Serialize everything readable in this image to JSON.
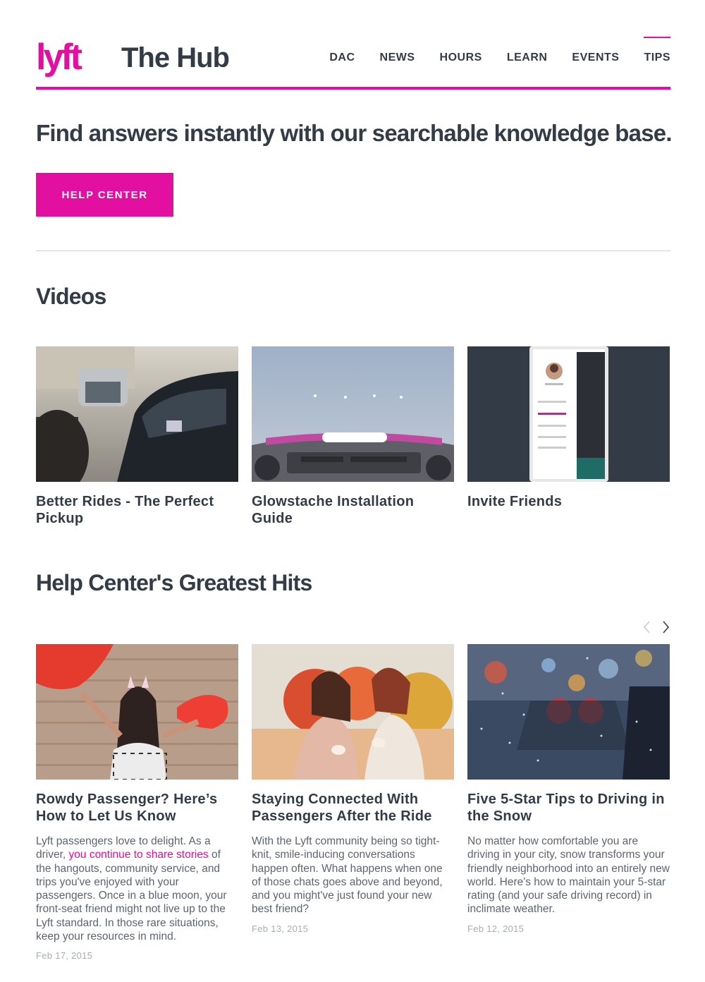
{
  "header": {
    "logo_text": "lyft",
    "site_title": "The Hub",
    "nav": [
      {
        "label": "DAC"
      },
      {
        "label": "NEWS"
      },
      {
        "label": "HOURS"
      },
      {
        "label": "LEARN"
      },
      {
        "label": "EVENTS"
      },
      {
        "label": "TIPS",
        "active": true
      }
    ]
  },
  "hero": {
    "heading": "Find answers instantly with our searchable knowledge base.",
    "button_label": "HELP CENTER"
  },
  "videos": {
    "title": "Videos",
    "items": [
      {
        "title": "Better Rides - The Perfect Pickup"
      },
      {
        "title": "Glowstache Installation Guide"
      },
      {
        "title": "Invite Friends"
      }
    ]
  },
  "hits": {
    "title": "Help Center's Greatest Hits",
    "prev_icon": "chevron-left-icon",
    "next_icon": "chevron-right-icon",
    "items": [
      {
        "title": "Rowdy Passenger? Here’s How to Let Us Know",
        "desc_before": "Lyft passengers love to delight. As a driver, ",
        "desc_link": "you continue to share stories",
        "desc_after": " of the hangouts, community service, and trips you've enjoyed with your passengers. Once in a blue moon, your front-seat friend might not live up to the Lyft standard. In those rare situations, keep your resources in mind.",
        "date": "Feb 17, 2015"
      },
      {
        "title": "Staying Connected With Passengers After the Ride",
        "desc_before": "With the Lyft community being so tight-knit, smile-inducing conversations happen often. What happens when one of those chats goes above and beyond, and you might've just found your new best friend?",
        "desc_link": "",
        "desc_after": "",
        "date": "Feb 13, 2015"
      },
      {
        "title": "Five 5-Star Tips to Driving in the Snow",
        "desc_before": "No matter how comfortable you are driving in your city, snow transforms your friendly neighborhood into an entirely new world. Here's how to maintain your 5-star rating (and your safe driving record) in inclimate weather.",
        "desc_link": "",
        "desc_after": "",
        "date": "Feb 12, 2015"
      }
    ]
  },
  "colors": {
    "brand": "#e20fa0",
    "text": "#333b47",
    "muted": "#a8adb3"
  }
}
